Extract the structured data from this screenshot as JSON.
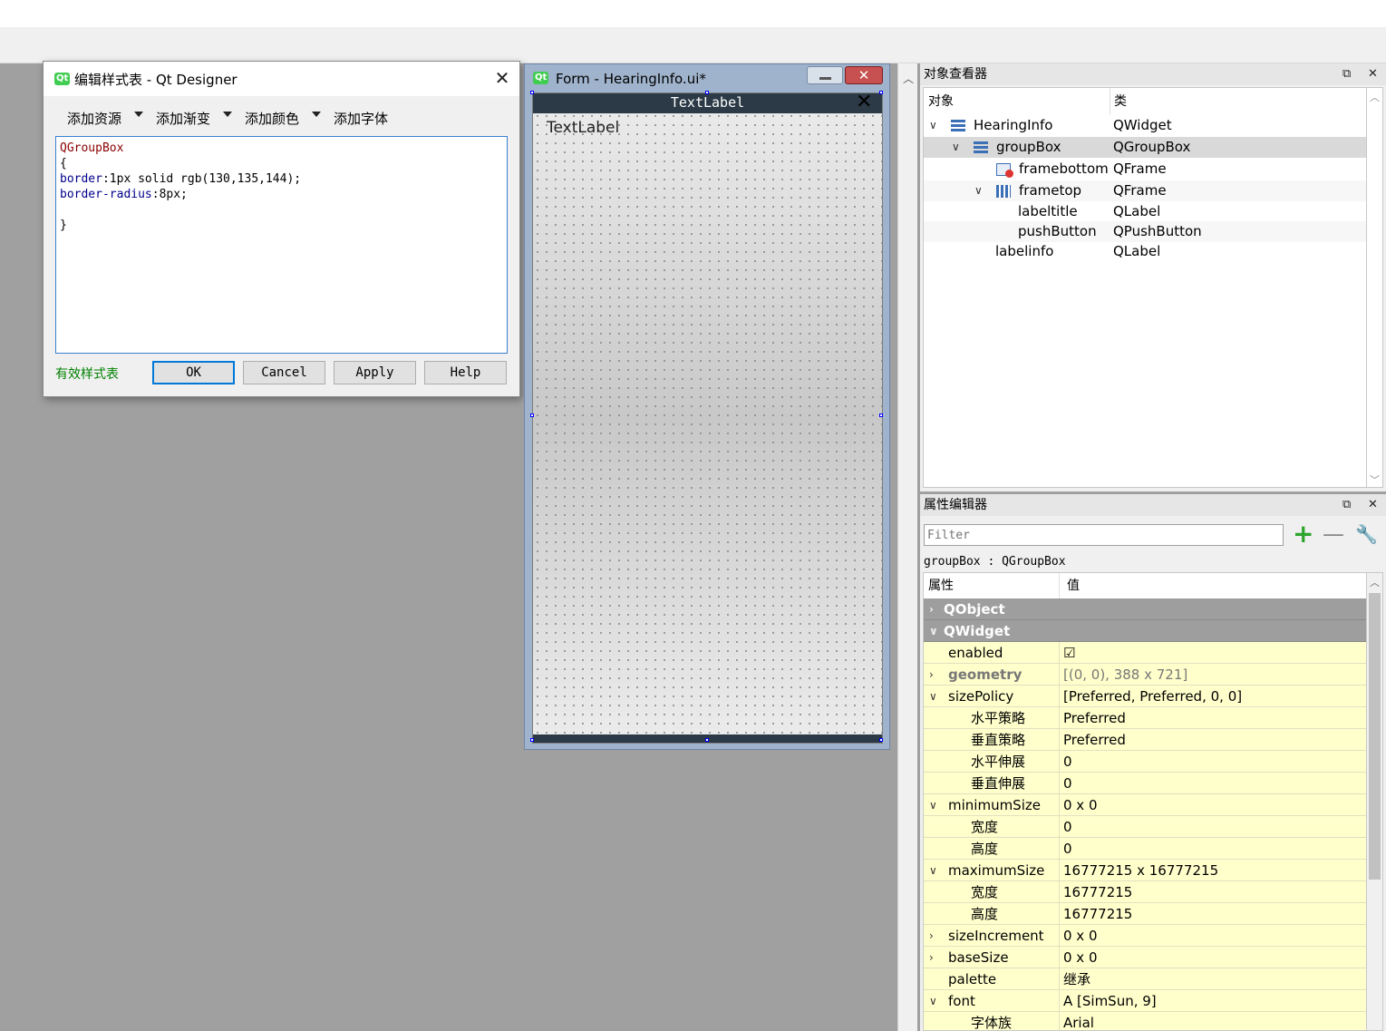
{
  "dialog": {
    "title": "编辑样式表 - Qt Designer",
    "toolbar": [
      "添加资源",
      "添加渐变",
      "添加颜色",
      "添加字体"
    ],
    "code_lines": [
      {
        "a": "QGroupBox",
        "b": ""
      },
      {
        "a": "{",
        "b": ""
      },
      {
        "a": "border",
        "b": ":1px solid rgb(130,135,144);"
      },
      {
        "a": "border-radius",
        "b": ":8px;"
      },
      {
        "a": "",
        "b": ""
      },
      {
        "a": "}",
        "b": ""
      }
    ],
    "status": "有效样式表",
    "buttons": {
      "ok": "OK",
      "cancel": "Cancel",
      "apply": "Apply",
      "help": "Help"
    }
  },
  "form_window": {
    "title": "Form - HearingInfo.ui*",
    "frametop_title": "TextLabel",
    "label_info": "TextLabel"
  },
  "object_inspector": {
    "title": "对象查看器",
    "col_object": "对象",
    "col_class": "类",
    "rows": [
      {
        "name": "HearingInfo",
        "cls": "QWidget"
      },
      {
        "name": "groupBox",
        "cls": "QGroupBox"
      },
      {
        "name": "framebottom",
        "cls": "QFrame"
      },
      {
        "name": "frametop",
        "cls": "QFrame"
      },
      {
        "name": "labeltitle",
        "cls": "QLabel"
      },
      {
        "name": "pushButton",
        "cls": "QPushButton"
      },
      {
        "name": "labelinfo",
        "cls": "QLabel"
      }
    ]
  },
  "property_editor": {
    "title": "属性编辑器",
    "filter_placeholder": "Filter",
    "object_line": "groupBox : QGroupBox",
    "col_property": "属性",
    "col_value": "值",
    "rows": [
      {
        "name": "QObject",
        "value": ""
      },
      {
        "name": "QWidget",
        "value": ""
      },
      {
        "name": "enabled",
        "value": "☑"
      },
      {
        "name": "geometry",
        "value": "[(0, 0), 388 x 721]"
      },
      {
        "name": "sizePolicy",
        "value": "[Preferred, Preferred, 0, 0]"
      },
      {
        "name": "水平策略",
        "value": "Preferred"
      },
      {
        "name": "垂直策略",
        "value": "Preferred"
      },
      {
        "name": "水平伸展",
        "value": "0"
      },
      {
        "name": "垂直伸展",
        "value": "0"
      },
      {
        "name": "minimumSize",
        "value": "0 x 0"
      },
      {
        "name": "宽度",
        "value": "0"
      },
      {
        "name": "高度",
        "value": "0"
      },
      {
        "name": "maximumSize",
        "value": "16777215 x 16777215"
      },
      {
        "name": "宽度",
        "value": "16777215"
      },
      {
        "name": "高度",
        "value": "16777215"
      },
      {
        "name": "sizeIncrement",
        "value": "0 x 0"
      },
      {
        "name": "baseSize",
        "value": "0 x 0"
      },
      {
        "name": "palette",
        "value": "继承"
      },
      {
        "name": "font",
        "value": "A  [SimSun, 9]"
      },
      {
        "name": "字体族",
        "value": "Arial"
      }
    ]
  },
  "colors": {
    "qt_green": "#41cd52",
    "dark_bar": "#2b3a46",
    "valid_green": "#008000",
    "selection_blue": "#0078d7",
    "property_yellow": "#ffffcc"
  }
}
